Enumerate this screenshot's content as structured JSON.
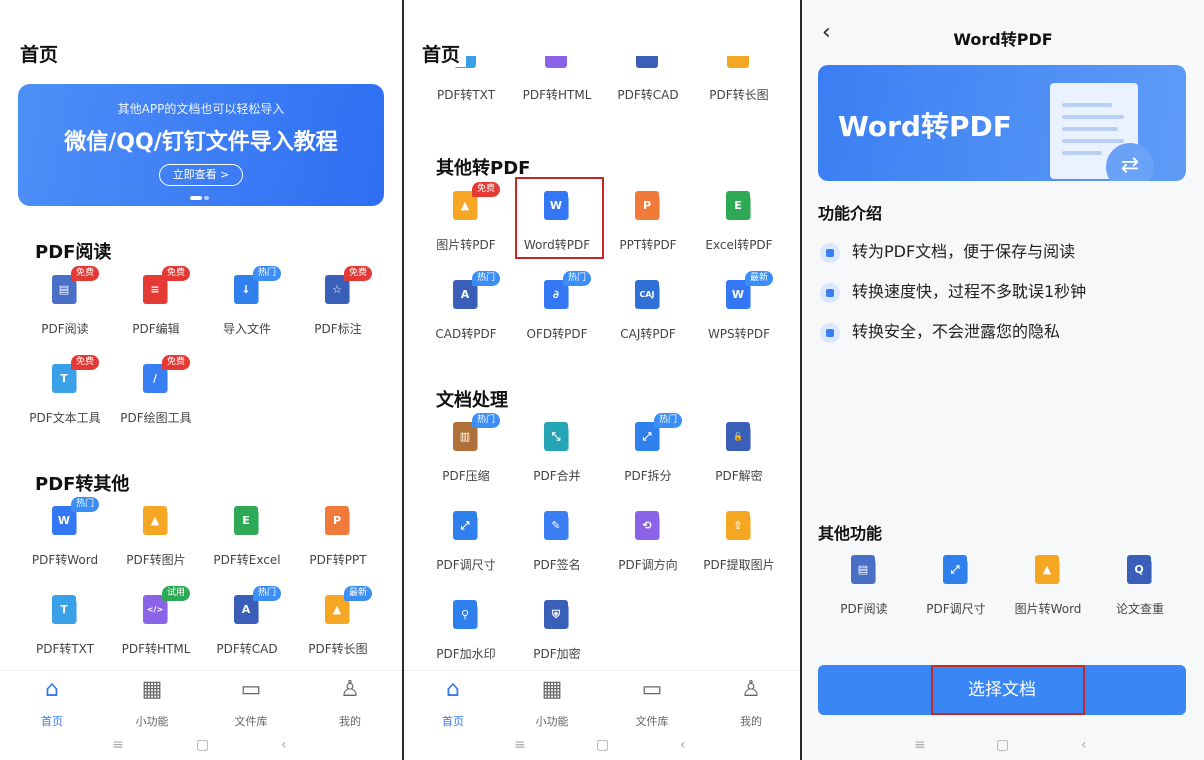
{
  "panel1": {
    "page_title": "首页",
    "banner": {
      "subtitle": "其他APP的文档也可以轻松导入",
      "title": "微信/QQ/钉钉文件导入教程",
      "button": "立即查看 >"
    },
    "section_read": "PDF阅读",
    "read_items": [
      {
        "label": "PDF阅读",
        "badge": "免费",
        "glyph": "▤"
      },
      {
        "label": "PDF编辑",
        "badge": "免费",
        "glyph": "≡"
      },
      {
        "label": "导入文件",
        "badge": "热门",
        "glyph": "↓"
      },
      {
        "label": "PDF标注",
        "badge": "免费",
        "glyph": "☆"
      },
      {
        "label": "PDF文本工具",
        "badge": "免费",
        "glyph": "T"
      },
      {
        "label": "PDF绘图工具",
        "badge": "免费",
        "glyph": "/"
      }
    ],
    "section_to_other": "PDF转其他",
    "to_other_items": [
      {
        "label": "PDF转Word",
        "badge": "热门",
        "glyph": "W"
      },
      {
        "label": "PDF转图片",
        "badge": "",
        "glyph": "▲"
      },
      {
        "label": "PDF转Excel",
        "badge": "",
        "glyph": "E"
      },
      {
        "label": "PDF转PPT",
        "badge": "",
        "glyph": "P"
      },
      {
        "label": "PDF转TXT",
        "badge": "",
        "glyph": "T"
      },
      {
        "label": "PDF转HTML",
        "badge": "试用",
        "glyph": "</>"
      },
      {
        "label": "PDF转CAD",
        "badge": "热门",
        "glyph": "A"
      },
      {
        "label": "PDF转长图",
        "badge": "最新",
        "glyph": "▲"
      }
    ]
  },
  "panel2": {
    "page_title": "首页",
    "top_strip": [
      {
        "label": "PDF转TXT"
      },
      {
        "label": "PDF转HTML"
      },
      {
        "label": "PDF转CAD"
      },
      {
        "label": "PDF转长图"
      }
    ],
    "section_other_to_pdf": "其他转PDF",
    "other_to_pdf_items": [
      {
        "label": "图片转PDF",
        "badge": "免费",
        "glyph": "▲"
      },
      {
        "label": "Word转PDF",
        "badge": "",
        "glyph": "W"
      },
      {
        "label": "PPT转PDF",
        "badge": "",
        "glyph": "P"
      },
      {
        "label": "Excel转PDF",
        "badge": "",
        "glyph": "E"
      },
      {
        "label": "CAD转PDF",
        "badge": "热门",
        "glyph": "A"
      },
      {
        "label": "OFD转PDF",
        "badge": "热门",
        "glyph": "∂"
      },
      {
        "label": "CAJ转PDF",
        "badge": "",
        "glyph": "CAJ"
      },
      {
        "label": "WPS转PDF",
        "badge": "最新",
        "glyph": "W"
      }
    ],
    "section_doc": "文档处理",
    "doc_items": [
      {
        "label": "PDF压缩",
        "badge": "热门",
        "glyph": "▥"
      },
      {
        "label": "PDF合并",
        "badge": "",
        "glyph": "⤡"
      },
      {
        "label": "PDF拆分",
        "badge": "热门",
        "glyph": "⤢"
      },
      {
        "label": "PDF解密",
        "badge": "",
        "glyph": "🔓"
      },
      {
        "label": "PDF调尺寸",
        "badge": "",
        "glyph": "⤢"
      },
      {
        "label": "PDF签名",
        "badge": "",
        "glyph": "✎"
      },
      {
        "label": "PDF调方向",
        "badge": "",
        "glyph": "⟲"
      },
      {
        "label": "PDF提取图片",
        "badge": "",
        "glyph": "⇧"
      },
      {
        "label": "PDF加水印",
        "badge": "",
        "glyph": "⚲"
      },
      {
        "label": "PDF加密",
        "badge": "",
        "glyph": "⛨"
      }
    ]
  },
  "tabs": [
    {
      "label": "首页",
      "icon": "home-icon"
    },
    {
      "label": "小功能",
      "icon": "grid-icon"
    },
    {
      "label": "文件库",
      "icon": "folder-icon"
    },
    {
      "label": "我的",
      "icon": "user-icon"
    }
  ],
  "panel3": {
    "title": "Word转PDF",
    "hero_title": "Word转PDF",
    "section_intro": "功能介绍",
    "features": [
      "转为PDF文档，便于保存与阅读",
      "转换速度快，过程不多耽误1秒钟",
      "转换安全，不会泄露您的隐私"
    ],
    "section_other": "其他功能",
    "other_items": [
      {
        "label": "PDF阅读",
        "glyph": "▤"
      },
      {
        "label": "PDF调尺寸",
        "glyph": "⤢"
      },
      {
        "label": "图片转Word",
        "glyph": "▲"
      },
      {
        "label": "论文查重",
        "glyph": "Q"
      }
    ],
    "select_button": "选择文档"
  },
  "colors": {
    "blue": "#3477f5",
    "red": "#e53935",
    "orange": "#f5a623",
    "green": "#2eaa57",
    "badge_hot": "#3a8ef6",
    "badge_free": "#e53935"
  }
}
